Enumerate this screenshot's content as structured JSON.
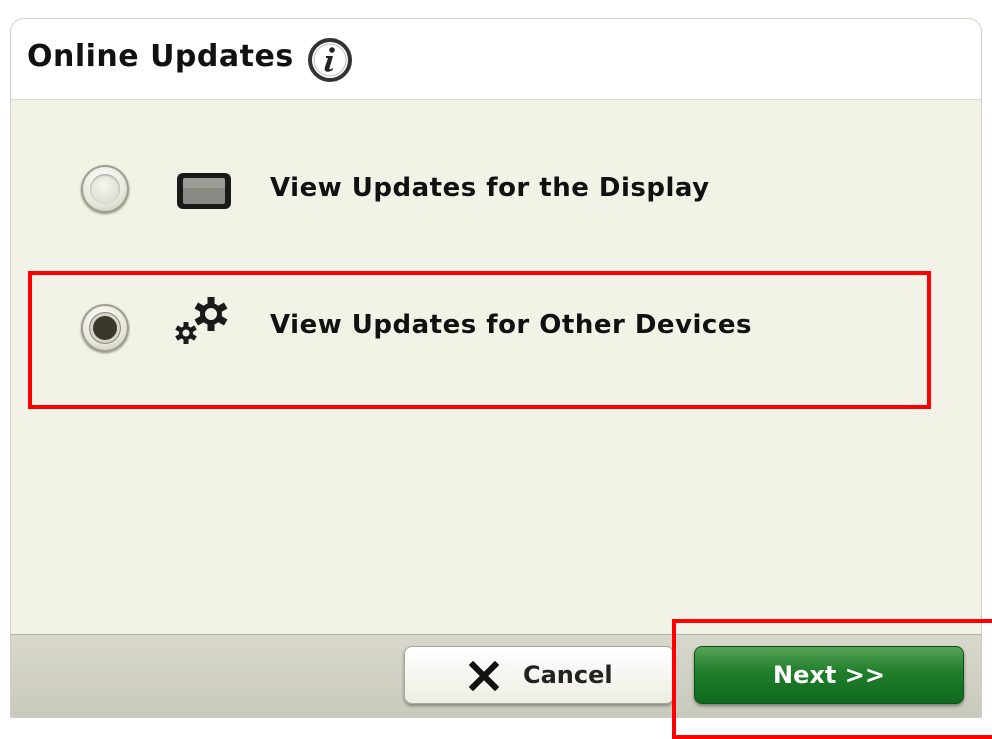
{
  "dialog": {
    "title": "Online Updates",
    "info_icon": "info-icon"
  },
  "options": [
    {
      "label": "View Updates for the Display",
      "icon": "display-icon",
      "selected": false
    },
    {
      "label": "View Updates for Other Devices",
      "icon": "gears-icon",
      "selected": true
    }
  ],
  "footer": {
    "cancel_label": "Cancel",
    "cancel_icon": "close-icon",
    "next_label": "Next >>"
  },
  "colors": {
    "accent_green": "#1f7d2a",
    "background": "#f3f2e6",
    "highlight_red": "#ff0000"
  }
}
